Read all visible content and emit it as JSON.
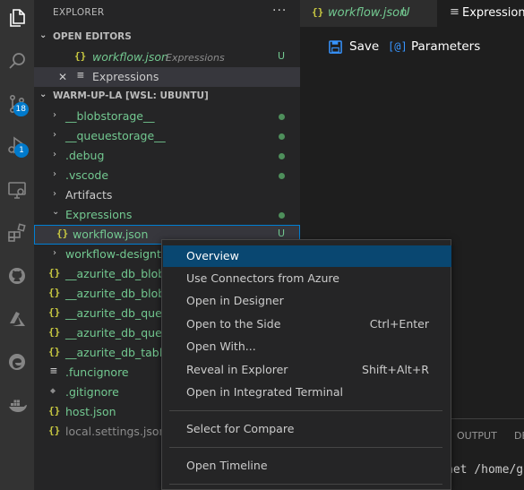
{
  "activity_bar": {
    "source_control_badge": "18",
    "run_debug_badge": "1"
  },
  "explorer": {
    "title": "EXPLORER",
    "more_label": "···",
    "open_editors": {
      "title": "OPEN EDITORS",
      "items": [
        {
          "icon": "{}",
          "name": "workflow.json",
          "description": "Expressions",
          "status": "U"
        },
        {
          "close": "✕",
          "icon": "≡",
          "name": "Expressions"
        }
      ]
    },
    "workspace": {
      "title": "WARM-UP-LA [WSL: UBUNTU]",
      "items": [
        {
          "chev": "›",
          "name": "__blobstorage__"
        },
        {
          "chev": "›",
          "name": "__queuestorage__"
        },
        {
          "chev": "›",
          "name": ".debug"
        },
        {
          "chev": "›",
          "name": ".vscode"
        },
        {
          "chev": "›",
          "name": "Artifacts"
        },
        {
          "chev": "⌄",
          "name": "Expressions"
        },
        {
          "icon": "{}",
          "name": "workflow.json",
          "status": "U"
        },
        {
          "chev": "›",
          "name": "workflow-designtime"
        },
        {
          "icon": "{}",
          "name": "__azurite_db_blob__.json"
        },
        {
          "icon": "{}",
          "name": "__azurite_db_blob_extent__.json"
        },
        {
          "icon": "{}",
          "name": "__azurite_db_queue__.json"
        },
        {
          "icon": "{}",
          "name": "__azurite_db_queue_extent__.json"
        },
        {
          "icon": "{}",
          "name": "__azurite_db_table__.json"
        },
        {
          "icon": "≡",
          "name": ".funcignore"
        },
        {
          "icon": "◆",
          "name": ".gitignore"
        },
        {
          "icon": "{}",
          "name": "host.json"
        },
        {
          "icon": "{}",
          "name": "local.settings.json"
        }
      ]
    }
  },
  "tabs": [
    {
      "icon": "{}",
      "name": "workflow.json",
      "status": "U"
    },
    {
      "icon": "≡",
      "name": "Expressions"
    }
  ],
  "toolbar": {
    "save_label": "Save",
    "parameters_icon": "[@]",
    "parameters_label": "Parameters"
  },
  "panel": {
    "output_tab": "OUTPUT",
    "debug_tab": "DE",
    "terminal_text": "net /home/ge"
  },
  "context_menu": {
    "items": [
      {
        "label": "Overview",
        "shortcut": ""
      },
      {
        "label": "Use Connectors from Azure",
        "shortcut": ""
      },
      {
        "label": "Open in Designer",
        "shortcut": ""
      },
      {
        "label": "Open to the Side",
        "shortcut": "Ctrl+Enter"
      },
      {
        "label": "Open With...",
        "shortcut": ""
      },
      {
        "label": "Reveal in Explorer",
        "shortcut": "Shift+Alt+R"
      },
      {
        "label": "Open in Integrated Terminal",
        "shortcut": ""
      },
      {
        "label": "Select for Compare",
        "shortcut": ""
      },
      {
        "label": "Open Timeline",
        "shortcut": ""
      }
    ]
  }
}
